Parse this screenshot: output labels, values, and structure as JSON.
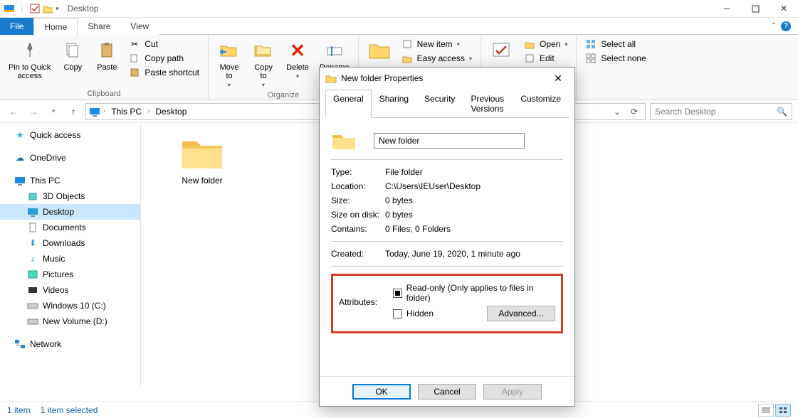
{
  "window": {
    "title": "Desktop"
  },
  "qat": {
    "props_checked": true
  },
  "tabs": {
    "file": "File",
    "home": "Home",
    "share": "Share",
    "view": "View"
  },
  "ribbon": {
    "pin": "Pin to Quick\naccess",
    "copy": "Copy",
    "paste": "Paste",
    "cut": "Cut",
    "copypath": "Copy path",
    "pasteshortcut": "Paste shortcut",
    "clipboard_label": "Clipboard",
    "moveto": "Move\nto",
    "copyto": "Copy\nto",
    "delete": "Delete",
    "rename": "Rename",
    "organize_label": "Organize",
    "newitem": "New item",
    "easyaccess": "Easy access",
    "open": "Open",
    "edit": "Edit",
    "selectall": "Select all",
    "selectnone": "Select none"
  },
  "nav_arrows": {
    "up_tooltip": "Up"
  },
  "breadcrumb": {
    "root": "This PC",
    "leaf": "Desktop"
  },
  "search": {
    "placeholder": "Search Desktop"
  },
  "navpane": {
    "quick": "Quick access",
    "onedrive": "OneDrive",
    "thispc": "This PC",
    "items": [
      "3D Objects",
      "Desktop",
      "Documents",
      "Downloads",
      "Music",
      "Pictures",
      "Videos",
      "Windows 10 (C:)",
      "New Volume (D:)"
    ],
    "network": "Network"
  },
  "file": {
    "name": "New folder"
  },
  "status": {
    "count": "1 item",
    "selected": "1 item selected"
  },
  "dialog": {
    "title": "New folder Properties",
    "tabs": [
      "General",
      "Sharing",
      "Security",
      "Previous Versions",
      "Customize"
    ],
    "name": "New folder",
    "type_k": "Type:",
    "type_v": "File folder",
    "loc_k": "Location:",
    "loc_v": "C:\\Users\\IEUser\\Desktop",
    "size_k": "Size:",
    "size_v": "0 bytes",
    "disk_k": "Size on disk:",
    "disk_v": "0 bytes",
    "cont_k": "Contains:",
    "cont_v": "0 Files, 0 Folders",
    "created_k": "Created:",
    "created_v": "Today, June 19, 2020, 1 minute ago",
    "attr_k": "Attributes:",
    "readonly": "Read-only (Only applies to files in folder)",
    "hidden": "Hidden",
    "advanced": "Advanced...",
    "ok": "OK",
    "cancel": "Cancel",
    "apply": "Apply"
  }
}
